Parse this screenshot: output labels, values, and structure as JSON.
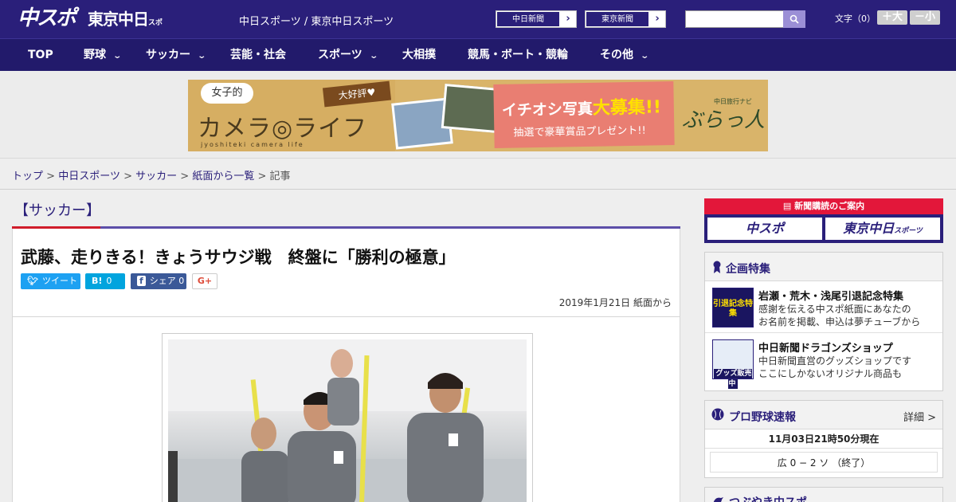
{
  "header": {
    "logo_chuspo": "中スポ",
    "logo_tokyo": "東京中日",
    "logo_tokyo_small": "スポーツ",
    "site_links": "中日スポーツ / 東京中日スポーツ",
    "paper_buttons": [
      "中日新聞",
      "東京新聞"
    ],
    "font_size_label": "文字（0）",
    "font_plus": "＋大",
    "font_minus": "－小",
    "search": {
      "placeholder": ""
    }
  },
  "nav": {
    "items": [
      "TOP",
      "野球",
      "サッカー",
      "芸能・社会",
      "スポーツ",
      "大相撲",
      "競馬・ボート・競輪",
      "その他"
    ]
  },
  "banner": {
    "cloud_text": "女子的",
    "title": "カメラ◎ライフ",
    "subtitle": "jyoshiteki camera life",
    "tag": "大好評♥",
    "pink_line1_a": "イチオシ写真",
    "pink_line1_b": "大募集!!",
    "pink_line2": "抽選で豪華賞品プレゼント!!",
    "brand_small": "中日旅行ナビ",
    "brand": "ぶらっ人"
  },
  "breadcrumb": {
    "items": [
      "トップ",
      "中日スポーツ",
      "サッカー",
      "紙面から一覧"
    ],
    "current": "記事",
    "separator": ">"
  },
  "article": {
    "category": "【サッカー】",
    "title": "武藤、走りきる！きょうサウジ戦　終盤に「勝利の極意」",
    "share": {
      "tweet": "ツイート",
      "hatena_count": "0",
      "fb_label": "シェア",
      "fb_count": "0",
      "gplus": "G+"
    },
    "date": "2019年1月21日 紙面から"
  },
  "sidebar": {
    "subscribe": {
      "header": "新聞購読のご案内",
      "buttons": [
        "中スポ",
        "東京中日"
      ],
      "tokyo_small": "スポーツ"
    },
    "features": {
      "title": "企画特集",
      "items": [
        {
          "title": "岩瀬・荒木・浅尾引退記念特集",
          "desc1": "感謝を伝える中スポ紙面にあなたの",
          "desc2": "お名前を掲載、申込は夢チューブから",
          "thumb": "引退記念特集"
        },
        {
          "title": "中日新聞ドラゴンズショップ",
          "desc1": "中日新聞直営のグッズショップです",
          "desc2": "ここにしかないオリジナル商品も",
          "thumb": "グッズ販売中"
        }
      ]
    },
    "baseball": {
      "title": "プロ野球速報",
      "detail": "詳細 >",
      "date": "11月03日21時50分現在",
      "score": "広 0 − 2 ソ （終了）"
    },
    "tsubuyaki": {
      "title": "つぶやき中スポ"
    }
  },
  "colors": {
    "brand_navy": "#2a1f7a",
    "accent_red": "#d01c2a",
    "twitter": "#1da1f2",
    "hatena": "#00a4de",
    "facebook": "#3b5998"
  }
}
